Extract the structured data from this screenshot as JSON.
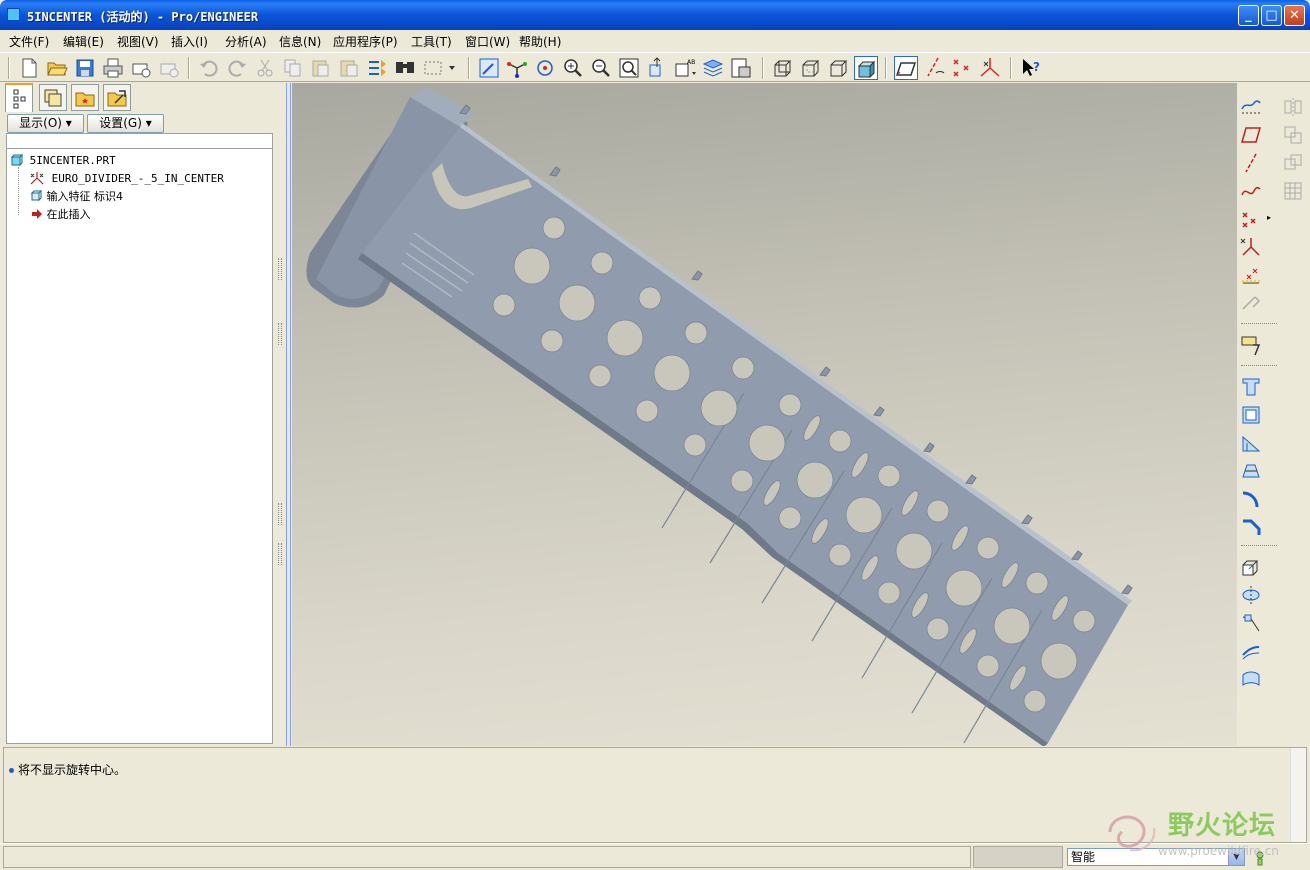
{
  "window": {
    "title": "5INCENTER (活动的) - Pro/ENGINEER",
    "minimize": "_",
    "maximize": "□",
    "close": "✕"
  },
  "menubar": {
    "items": [
      {
        "label": "文件(F)"
      },
      {
        "label": "编辑(E)"
      },
      {
        "label": "视图(V)"
      },
      {
        "label": "插入(I)"
      },
      {
        "label": "分析(A)"
      },
      {
        "label": "信息(N)"
      },
      {
        "label": "应用程序(P)"
      },
      {
        "label": "工具(T)"
      },
      {
        "label": "窗口(W)"
      },
      {
        "label": "帮助(H)"
      }
    ]
  },
  "toolbar": {
    "icons": [
      "new-icon",
      "open-icon",
      "save-icon",
      "print-icon",
      "send-mail-icon",
      "mail-disabled-icon",
      "undo-icon",
      "redo-icon",
      "cut-icon",
      "copy-icon",
      "paste-icon",
      "paste-special-icon",
      "regenerate-icon",
      "find-icon",
      "select-box-icon",
      "repaint-icon",
      "spin-center-icon",
      "orient-mode-icon",
      "zoom-in-icon",
      "zoom-out-icon",
      "refit-icon",
      "reorient-icon",
      "saved-views-icon",
      "layers-icon",
      "view-manager-icon",
      "wireframe-icon",
      "hidden-line-icon",
      "no-hidden-icon",
      "shading-icon",
      "datum-planes-icon",
      "datum-axes-icon",
      "datum-points-icon",
      "coordinate-systems-icon",
      "context-help-icon"
    ]
  },
  "model_tree": {
    "tabs": [
      "model-tree-tab",
      "layers-tab",
      "favorites-tab",
      "folder-browser-tab"
    ],
    "show_button": "显示(O)",
    "settings_button": "设置(G)",
    "items": [
      {
        "label": "5INCENTER.PRT",
        "icon": "part-icon"
      },
      {
        "label": "EURO_DIVIDER_-_5_IN_CENTER",
        "icon": "csys-icon"
      },
      {
        "label": "输入特征 标识4",
        "icon": "import-feature-icon"
      },
      {
        "label": "在此插入",
        "icon": "insert-here-arrow-icon"
      }
    ]
  },
  "message_area": {
    "message": "将不显示旋转中心。"
  },
  "statusbar": {
    "filter_value": "智能"
  },
  "watermark": {
    "text": "野火论坛",
    "url": "www.proewildfire.cn"
  },
  "colors": {
    "title_blue": "#0b55d8",
    "part_color": "#8f9db0",
    "viewport_bg": "#d6d3c6"
  }
}
